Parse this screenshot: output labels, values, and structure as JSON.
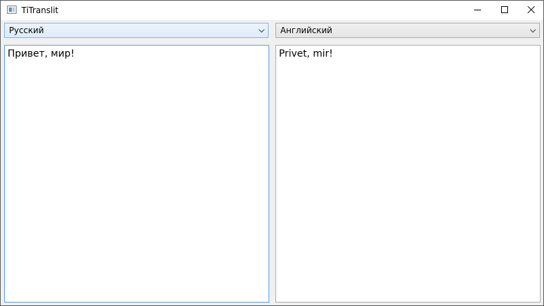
{
  "window": {
    "title": "TiTranslit",
    "controls": {
      "minimize_icon": "minimize-icon",
      "maximize_icon": "maximize-icon",
      "close_icon": "close-icon"
    }
  },
  "source_language": {
    "selected": "Русский"
  },
  "target_language": {
    "selected": "Английский"
  },
  "source_text": "Привет, мир!",
  "output_text": "Privet, mir!",
  "colors": {
    "focus_border": "#569de5",
    "combo_hover_border": "#7eb4ea"
  }
}
